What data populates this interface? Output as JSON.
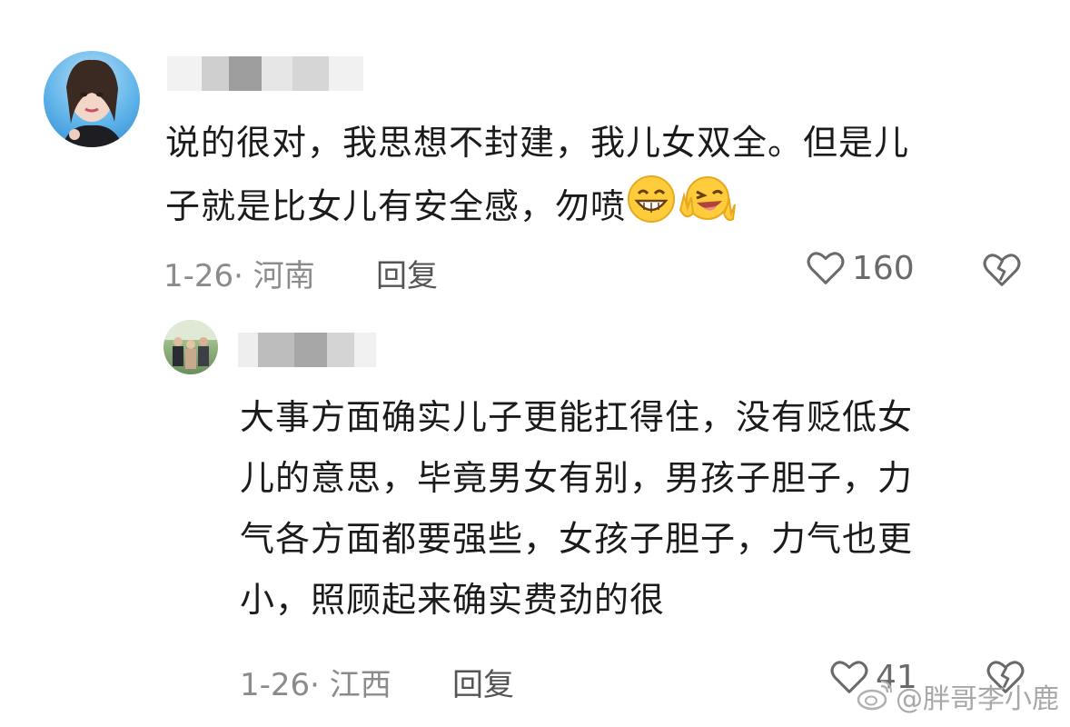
{
  "comment": {
    "text_line1": "说的很对，我思想不封建，我儿女双全。但是儿",
    "text_line2": "子就是比女儿有安全感，勿喷",
    "emojis": [
      "grinning-face-icon",
      "winking-victory-face-icon"
    ],
    "date": "1-26",
    "location": "河南",
    "reply_label": "回复",
    "like_count": "160"
  },
  "reply": {
    "text_lines": [
      "大事方面确实儿子更能扛得住，没有贬低女",
      "儿的意思，毕竟男女有别，男孩子胆子，力",
      "气各方面都要强些，女孩子胆子，力气也更",
      "小，照顾起来确实费劲的很"
    ],
    "date": "1-26",
    "location": "江西",
    "reply_label": "回复",
    "like_count": "41"
  },
  "watermark": {
    "text": "@胖哥李小鹿",
    "icon": "weibo-icon"
  },
  "colors": {
    "text": "#1b1b1b",
    "meta": "#8b8b8b",
    "icon": "#6a6a6a"
  }
}
